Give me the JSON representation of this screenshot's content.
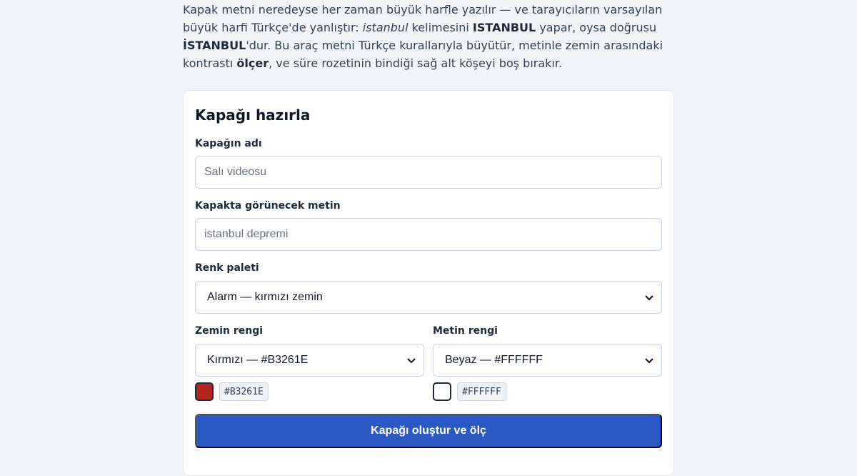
{
  "intro": {
    "t1": "Kapak metni neredeyse her zaman büyük harfle yazılır — ve tarayıcıların varsayılan büyük harfi Türkçe'de yanlıştır: ",
    "t2": "istanbul",
    "t3": " kelimesini ",
    "t4": "ISTANBUL",
    "t5": " yapar, oysa doğrusu ",
    "t6": "İSTANBUL",
    "t7": "'dur. Bu araç metni Türkçe kurallarıyla büyütür, metinle zemin arasındaki kontrastı ",
    "t8": "ölçer",
    "t9": ", ve süre rozetinin bindiği sağ alt köşeyi boş bırakır."
  },
  "form": {
    "title": "Kapağı hazırla",
    "name_label": "Kapağın adı",
    "name_placeholder": "Salı videosu",
    "text_label": "Kapakta görünecek metin",
    "text_placeholder": "istanbul depremi",
    "palette_label": "Renk paleti",
    "palette_value": "Alarm — kırmızı zemin",
    "bg_label": "Zemin rengi",
    "bg_value": "Kırmızı — #B3261E",
    "bg_hex": "#B3261E",
    "fg_label": "Metin rengi",
    "fg_value": "Beyaz — #FFFFFF",
    "fg_hex": "#FFFFFF",
    "submit_label": "Kapağı oluştur ve ölç"
  },
  "colors": {
    "bg_swatch": "#B3261E",
    "fg_swatch": "#FFFFFF",
    "accent": "#2B59C3"
  }
}
